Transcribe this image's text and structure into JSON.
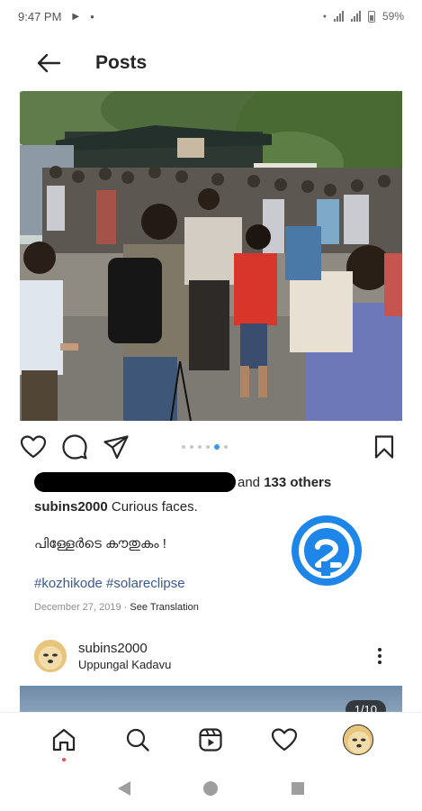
{
  "status": {
    "time": "9:47 PM",
    "battery": "59%"
  },
  "header": {
    "title": "Posts"
  },
  "post": {
    "carousel_count": 6,
    "carousel_active": 5,
    "likes_suffix": "and ",
    "likes_count": "133 others",
    "caption_user": "subins2000",
    "caption_text": " Curious faces.",
    "caption_malayalam": "പിള്ളേർടെ കൗതുകം !",
    "hashtags": "#kozhikode #solareclipse",
    "date": "December 27, 2019",
    "separator": " · ",
    "see_translation": "See Translation"
  },
  "next_post": {
    "username": "subins2000",
    "location": "Uppungal Kadavu",
    "counter": "1/10"
  },
  "colors": {
    "accent": "#3897f0",
    "hashtag": "#385898",
    "watermark": "#1e86e8"
  },
  "icons": {
    "back": "arrow-left-icon",
    "like": "heart-icon",
    "comment": "comment-icon",
    "share": "send-icon",
    "save": "bookmark-icon",
    "home": "home-icon",
    "search": "search-icon",
    "reels": "reels-icon",
    "activity": "heart-icon",
    "more": "more-vertical-icon"
  }
}
